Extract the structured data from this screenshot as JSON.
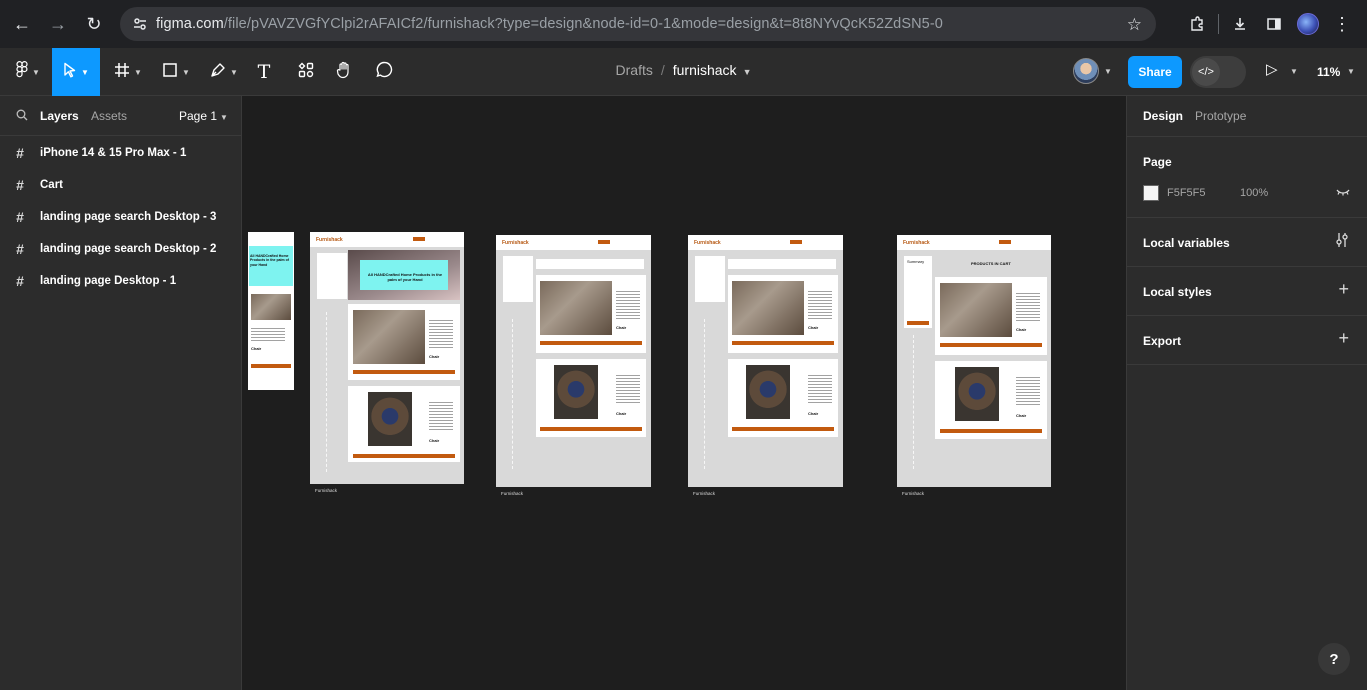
{
  "browser": {
    "url_host": "figma.com",
    "url_path": "/file/pVAVZVGfYClpi2rAFAICf2/furnishack?type=design&node-id=0-1&mode=design&t=8t8NYvQcK52ZdSN5-0"
  },
  "toolbar": {
    "breadcrumb_drafts": "Drafts",
    "breadcrumb_slash": "/",
    "file_name": "furnishack",
    "share_label": "Share",
    "zoom": "11%"
  },
  "left_panel": {
    "tab_layers": "Layers",
    "tab_assets": "Assets",
    "page_selector": "Page 1",
    "layers": [
      {
        "name": "iPhone 14 & 15 Pro Max - 1"
      },
      {
        "name": "Cart"
      },
      {
        "name": "landing page search Desktop - 3"
      },
      {
        "name": "landing page search Desktop - 2"
      },
      {
        "name": "landing page Desktop - 1"
      }
    ]
  },
  "canvas": {
    "hero_text": "All HANDCrafted Home Products in the palm of your Hand",
    "mobile_hero_text": "All HANDCrafted Home Products in the palm of your Hand",
    "product_chair": "Chair",
    "cart_heading": "PRODUCTS IN CART",
    "cart_summary": "Summary",
    "logo": "Furnishack"
  },
  "right_panel": {
    "tab_design": "Design",
    "tab_prototype": "Prototype",
    "page_label": "Page",
    "page_color": "F5F5F5",
    "page_opacity": "100%",
    "local_variables": "Local variables",
    "local_styles": "Local styles",
    "export": "Export"
  },
  "help_label": "?"
}
